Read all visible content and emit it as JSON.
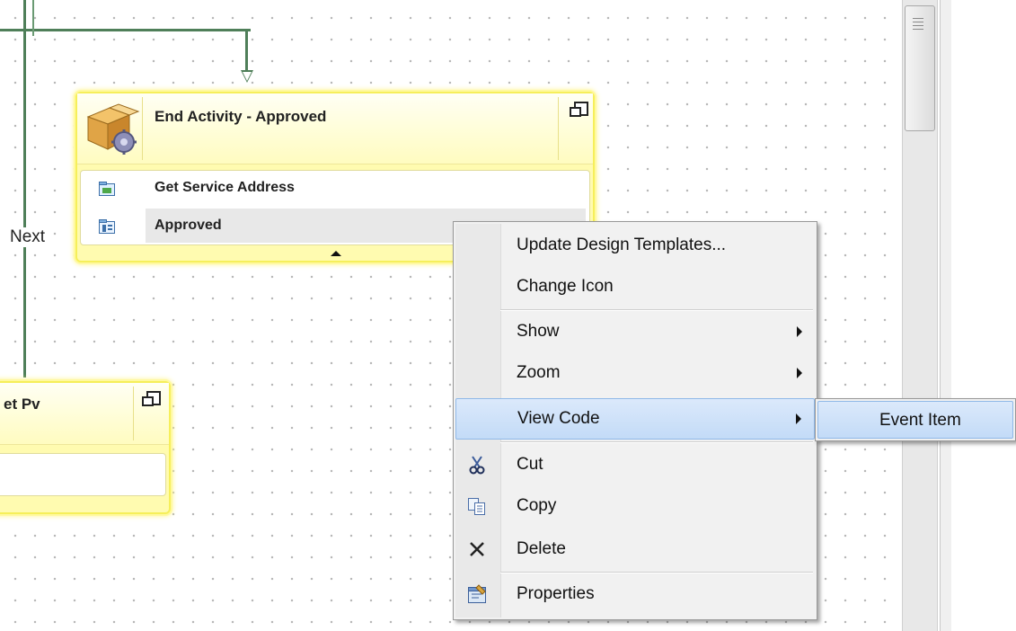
{
  "connector": {
    "label": "Next"
  },
  "node_main": {
    "title": "End Activity - Approved",
    "rows": [
      {
        "label": "Get Service Address",
        "icon": "service-icon"
      },
      {
        "label": "Approved",
        "icon": "record-icon",
        "selected": true
      }
    ]
  },
  "node_secondary": {
    "title": "et Pv"
  },
  "context_menu": {
    "items": [
      {
        "label": "Update Design Templates..."
      },
      {
        "label": "Change Icon"
      },
      {
        "label": "Show",
        "submenu": true
      },
      {
        "label": "Zoom",
        "submenu": true
      },
      {
        "label": "View Code",
        "submenu": true,
        "highlighted": true
      },
      {
        "label": "Cut",
        "icon": "scissors-icon"
      },
      {
        "label": "Copy",
        "icon": "copy-icon"
      },
      {
        "label": "Delete",
        "icon": "delete-icon"
      },
      {
        "label": "Properties",
        "icon": "properties-icon"
      }
    ]
  },
  "submenu": {
    "items": [
      {
        "label": "Event Item",
        "highlighted": true
      }
    ]
  },
  "colors": {
    "connector": "#4f7f59",
    "node_fill": "#fffbb0",
    "node_border": "#f6ef5a",
    "menu_highlight": "#c3dbf7"
  }
}
